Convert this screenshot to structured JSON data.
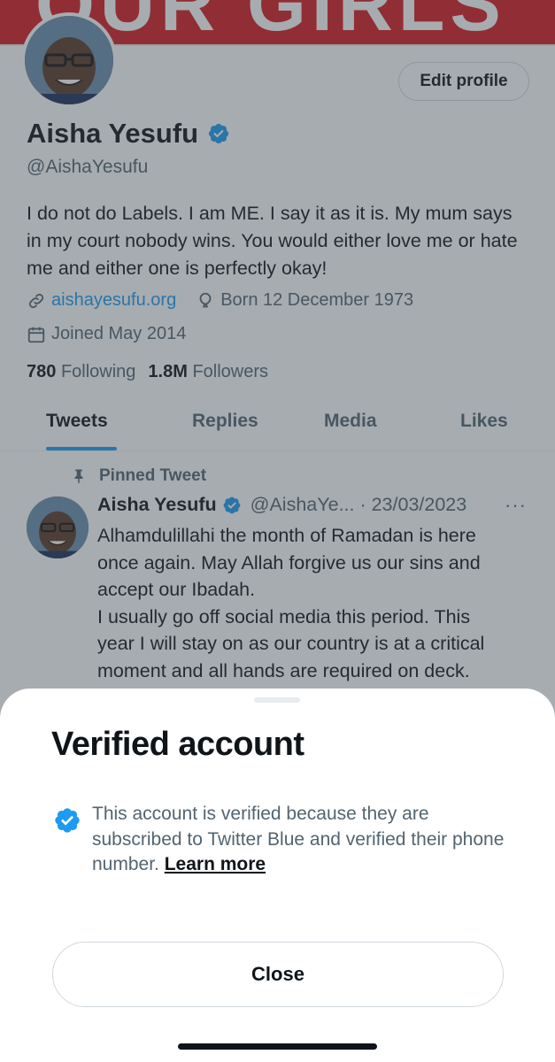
{
  "banner": {
    "text": "OUR GIRLS"
  },
  "profile": {
    "edit_label": "Edit profile",
    "name": "Aisha Yesufu",
    "handle": "@AishaYesufu",
    "bio": "I do not do Labels. I am ME. I say it as it is. My mum says in my court nobody wins. You would either love me or hate me and either one is perfectly okay!",
    "website": "aishayesufu.org",
    "born": "Born 12 December 1973",
    "joined": "Joined May 2014",
    "following_count": "780",
    "following_label": "Following",
    "followers_count": "1.8M",
    "followers_label": "Followers"
  },
  "tabs": [
    {
      "label": "Tweets",
      "active": true
    },
    {
      "label": "Replies"
    },
    {
      "label": "Media"
    },
    {
      "label": "Likes"
    }
  ],
  "tweet": {
    "pinned_label": "Pinned Tweet",
    "name": "Aisha Yesufu",
    "handle_date": "@AishaYe... · 23/03/2023",
    "more": "···",
    "lines": [
      "Alhamdulillahi the month of Ramadan is here",
      "once again. May Allah forgive us our sins and",
      "accept our Ibadah.",
      "I usually go off social media this period. This",
      "year I will stay on as our country is at a critical",
      "moment and all hands are required on deck."
    ]
  },
  "sheet": {
    "title": "Verified account",
    "text": "This account is verified because they are subscribed to Twitter Blue and verified their phone number.",
    "learn_more": "Learn more",
    "close_label": "Close"
  },
  "colors": {
    "accent": "#1d9bf0",
    "banner_red": "#d71a20",
    "secondary_text": "#536471"
  }
}
